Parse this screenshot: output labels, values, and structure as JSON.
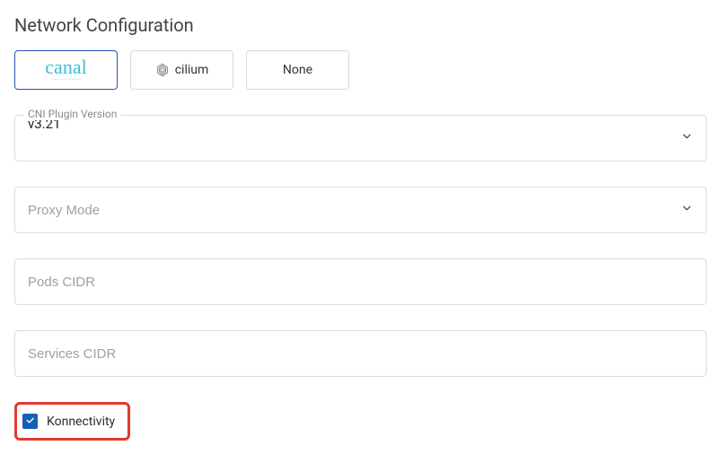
{
  "section": {
    "title": "Network Configuration"
  },
  "cni_options": {
    "canal": "canal",
    "cilium": "cilium",
    "none": "None",
    "selected": "canal"
  },
  "fields": {
    "cni_version": {
      "label": "CNI Plugin Version",
      "value": "v3.21"
    },
    "proxy_mode": {
      "placeholder": "Proxy Mode",
      "value": ""
    },
    "pods_cidr": {
      "placeholder": "Pods CIDR",
      "value": ""
    },
    "services_cidr": {
      "placeholder": "Services CIDR",
      "value": ""
    }
  },
  "konnectivity": {
    "label": "Konnectivity",
    "checked": true
  }
}
